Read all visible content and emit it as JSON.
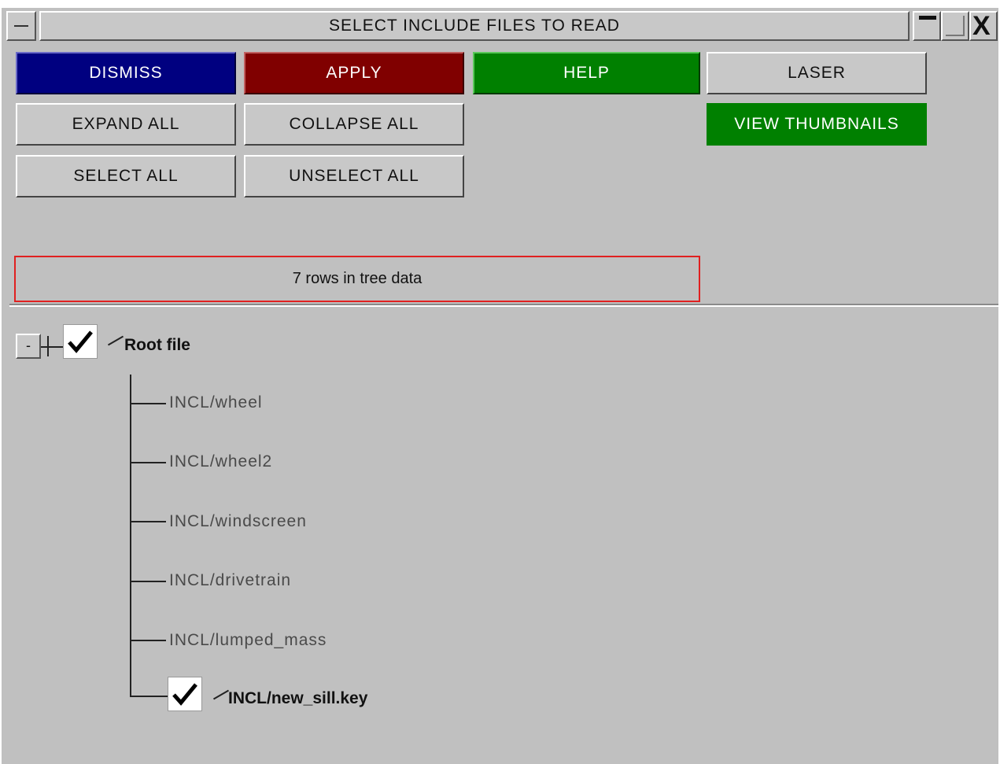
{
  "window": {
    "title": "SELECT INCLUDE FILES TO READ",
    "controls": {
      "close": "X"
    }
  },
  "buttons": {
    "dismiss": "DISMISS",
    "apply": "APPLY",
    "help": "HELP",
    "laser": "LASER",
    "expand_all": "EXPAND ALL",
    "collapse_all": "COLLAPSE ALL",
    "view_thumbnails": "VIEW THUMBNAILS",
    "select_all": "SELECT ALL",
    "unselect_all": "UNSELECT ALL"
  },
  "status": {
    "rows_text": "7 rows in tree data"
  },
  "tree": {
    "collapse_symbol": "-",
    "root": {
      "label": "Root file",
      "checked": true
    },
    "children": [
      {
        "label": "INCL/wheel",
        "checked": false
      },
      {
        "label": "INCL/wheel2",
        "checked": false
      },
      {
        "label": "INCL/windscreen",
        "checked": false
      },
      {
        "label": "INCL/drivetrain",
        "checked": false
      },
      {
        "label": "INCL/lumped_mass",
        "checked": false
      },
      {
        "label": "INCL/new_sill.key",
        "checked": true
      }
    ]
  },
  "colors": {
    "dismiss": "#000080",
    "apply": "#800000",
    "help": "#008000",
    "view_thumbnails": "#008000",
    "status_border": "#e02020",
    "background": "#c0c0c0"
  }
}
